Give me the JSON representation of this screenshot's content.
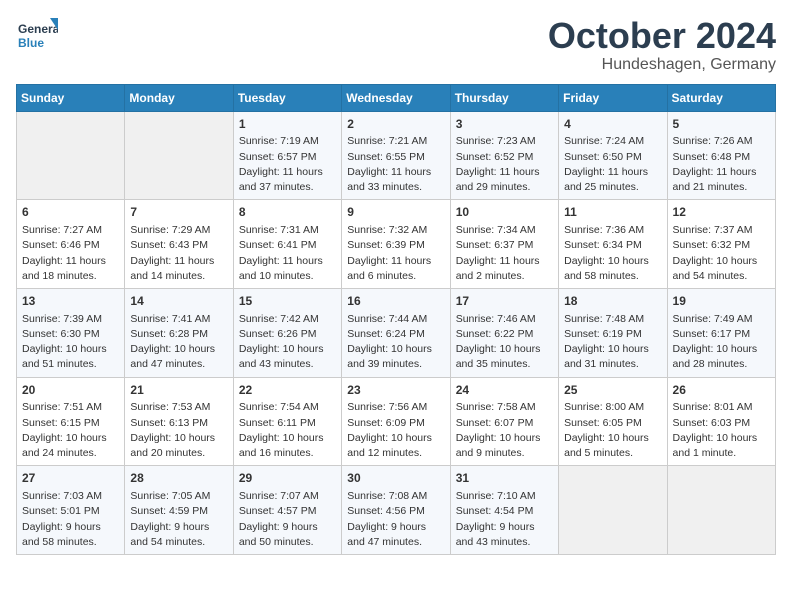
{
  "header": {
    "logo_text_general": "General",
    "logo_text_blue": "Blue",
    "month_title": "October 2024",
    "location": "Hundeshagen, Germany"
  },
  "calendar": {
    "days_of_week": [
      "Sunday",
      "Monday",
      "Tuesday",
      "Wednesday",
      "Thursday",
      "Friday",
      "Saturday"
    ],
    "weeks": [
      [
        {
          "day": "",
          "info": ""
        },
        {
          "day": "",
          "info": ""
        },
        {
          "day": "1",
          "info": "Sunrise: 7:19 AM\nSunset: 6:57 PM\nDaylight: 11 hours\nand 37 minutes."
        },
        {
          "day": "2",
          "info": "Sunrise: 7:21 AM\nSunset: 6:55 PM\nDaylight: 11 hours\nand 33 minutes."
        },
        {
          "day": "3",
          "info": "Sunrise: 7:23 AM\nSunset: 6:52 PM\nDaylight: 11 hours\nand 29 minutes."
        },
        {
          "day": "4",
          "info": "Sunrise: 7:24 AM\nSunset: 6:50 PM\nDaylight: 11 hours\nand 25 minutes."
        },
        {
          "day": "5",
          "info": "Sunrise: 7:26 AM\nSunset: 6:48 PM\nDaylight: 11 hours\nand 21 minutes."
        }
      ],
      [
        {
          "day": "6",
          "info": "Sunrise: 7:27 AM\nSunset: 6:46 PM\nDaylight: 11 hours\nand 18 minutes."
        },
        {
          "day": "7",
          "info": "Sunrise: 7:29 AM\nSunset: 6:43 PM\nDaylight: 11 hours\nand 14 minutes."
        },
        {
          "day": "8",
          "info": "Sunrise: 7:31 AM\nSunset: 6:41 PM\nDaylight: 11 hours\nand 10 minutes."
        },
        {
          "day": "9",
          "info": "Sunrise: 7:32 AM\nSunset: 6:39 PM\nDaylight: 11 hours\nand 6 minutes."
        },
        {
          "day": "10",
          "info": "Sunrise: 7:34 AM\nSunset: 6:37 PM\nDaylight: 11 hours\nand 2 minutes."
        },
        {
          "day": "11",
          "info": "Sunrise: 7:36 AM\nSunset: 6:34 PM\nDaylight: 10 hours\nand 58 minutes."
        },
        {
          "day": "12",
          "info": "Sunrise: 7:37 AM\nSunset: 6:32 PM\nDaylight: 10 hours\nand 54 minutes."
        }
      ],
      [
        {
          "day": "13",
          "info": "Sunrise: 7:39 AM\nSunset: 6:30 PM\nDaylight: 10 hours\nand 51 minutes."
        },
        {
          "day": "14",
          "info": "Sunrise: 7:41 AM\nSunset: 6:28 PM\nDaylight: 10 hours\nand 47 minutes."
        },
        {
          "day": "15",
          "info": "Sunrise: 7:42 AM\nSunset: 6:26 PM\nDaylight: 10 hours\nand 43 minutes."
        },
        {
          "day": "16",
          "info": "Sunrise: 7:44 AM\nSunset: 6:24 PM\nDaylight: 10 hours\nand 39 minutes."
        },
        {
          "day": "17",
          "info": "Sunrise: 7:46 AM\nSunset: 6:22 PM\nDaylight: 10 hours\nand 35 minutes."
        },
        {
          "day": "18",
          "info": "Sunrise: 7:48 AM\nSunset: 6:19 PM\nDaylight: 10 hours\nand 31 minutes."
        },
        {
          "day": "19",
          "info": "Sunrise: 7:49 AM\nSunset: 6:17 PM\nDaylight: 10 hours\nand 28 minutes."
        }
      ],
      [
        {
          "day": "20",
          "info": "Sunrise: 7:51 AM\nSunset: 6:15 PM\nDaylight: 10 hours\nand 24 minutes."
        },
        {
          "day": "21",
          "info": "Sunrise: 7:53 AM\nSunset: 6:13 PM\nDaylight: 10 hours\nand 20 minutes."
        },
        {
          "day": "22",
          "info": "Sunrise: 7:54 AM\nSunset: 6:11 PM\nDaylight: 10 hours\nand 16 minutes."
        },
        {
          "day": "23",
          "info": "Sunrise: 7:56 AM\nSunset: 6:09 PM\nDaylight: 10 hours\nand 12 minutes."
        },
        {
          "day": "24",
          "info": "Sunrise: 7:58 AM\nSunset: 6:07 PM\nDaylight: 10 hours\nand 9 minutes."
        },
        {
          "day": "25",
          "info": "Sunrise: 8:00 AM\nSunset: 6:05 PM\nDaylight: 10 hours\nand 5 minutes."
        },
        {
          "day": "26",
          "info": "Sunrise: 8:01 AM\nSunset: 6:03 PM\nDaylight: 10 hours\nand 1 minute."
        }
      ],
      [
        {
          "day": "27",
          "info": "Sunrise: 7:03 AM\nSunset: 5:01 PM\nDaylight: 9 hours\nand 58 minutes."
        },
        {
          "day": "28",
          "info": "Sunrise: 7:05 AM\nSunset: 4:59 PM\nDaylight: 9 hours\nand 54 minutes."
        },
        {
          "day": "29",
          "info": "Sunrise: 7:07 AM\nSunset: 4:57 PM\nDaylight: 9 hours\nand 50 minutes."
        },
        {
          "day": "30",
          "info": "Sunrise: 7:08 AM\nSunset: 4:56 PM\nDaylight: 9 hours\nand 47 minutes."
        },
        {
          "day": "31",
          "info": "Sunrise: 7:10 AM\nSunset: 4:54 PM\nDaylight: 9 hours\nand 43 minutes."
        },
        {
          "day": "",
          "info": ""
        },
        {
          "day": "",
          "info": ""
        }
      ]
    ]
  }
}
